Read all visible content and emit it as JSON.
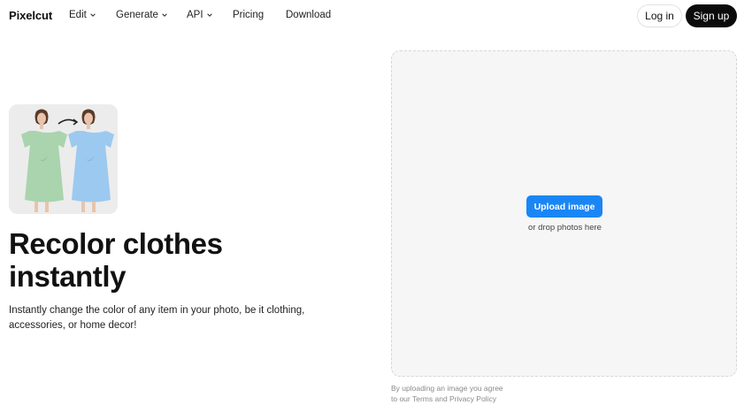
{
  "header": {
    "logo": "Pixelcut",
    "nav": [
      {
        "label": "Edit",
        "has_menu": true
      },
      {
        "label": "Generate",
        "has_menu": true
      },
      {
        "label": "API",
        "has_menu": true
      },
      {
        "label": "Pricing",
        "has_menu": false
      },
      {
        "label": "Download",
        "has_menu": false
      }
    ],
    "login_label": "Log in",
    "signup_label": "Sign up"
  },
  "hero": {
    "title_line1": "Recolor clothes",
    "title_line2": "instantly",
    "description_line1": "Instantly change the color of any item in your photo, be it clothing,",
    "description_line2": "accessories, or home decor!",
    "thumbnail": {
      "before_color": "#a9d4ad",
      "after_color": "#9cc9ef"
    }
  },
  "upload": {
    "button_label": "Upload image",
    "drop_hint": "or drop photos here",
    "legal_line1": "By uploading an image you agree",
    "legal_prefix": "to our",
    "terms_label": "Terms",
    "and_label": "and",
    "privacy_label": "Privacy Policy"
  },
  "colors": {
    "accent": "#1a86f5",
    "signup_bg": "#0b0b0b",
    "panel_bg": "#f6f6f6"
  }
}
